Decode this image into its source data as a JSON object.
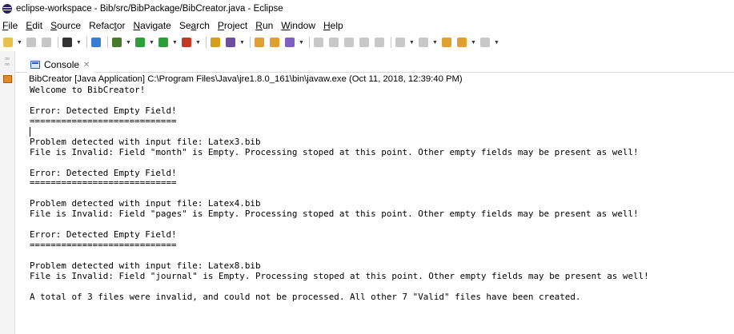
{
  "window": {
    "title": "eclipse-workspace - Bib/src/BibPackage/BibCreator.java - Eclipse",
    "app_icon": "eclipse-icon"
  },
  "menubar": {
    "items": [
      {
        "pre": "",
        "ul": "F",
        "post": "ile"
      },
      {
        "pre": "",
        "ul": "E",
        "post": "dit"
      },
      {
        "pre": "",
        "ul": "S",
        "post": "ource"
      },
      {
        "pre": "Refac",
        "ul": "t",
        "post": "or"
      },
      {
        "pre": "",
        "ul": "N",
        "post": "avigate"
      },
      {
        "pre": "Se",
        "ul": "a",
        "post": "rch"
      },
      {
        "pre": "",
        "ul": "P",
        "post": "roject"
      },
      {
        "pre": "",
        "ul": "R",
        "post": "un"
      },
      {
        "pre": "",
        "ul": "W",
        "post": "indow"
      },
      {
        "pre": "",
        "ul": "H",
        "post": "elp"
      }
    ]
  },
  "toolbar": {
    "icons": [
      {
        "name": "new-icon",
        "color": "#e8c14a",
        "dd": true
      },
      {
        "name": "save-icon",
        "color": "#c6c6c6",
        "dd": false
      },
      {
        "name": "save-all-icon",
        "color": "#c6c6c6",
        "dd": false
      },
      {
        "name": "sep"
      },
      {
        "name": "build-icon",
        "color": "#333333",
        "dd": true
      },
      {
        "name": "sep"
      },
      {
        "name": "skip-breakpoints-icon",
        "color": "#3a7bd5",
        "dd": false
      },
      {
        "name": "sep"
      },
      {
        "name": "debug-icon",
        "color": "#4a7a2e",
        "dd": true
      },
      {
        "name": "run-icon",
        "color": "#2f9e3a",
        "dd": true
      },
      {
        "name": "coverage-icon",
        "color": "#2f9e3a",
        "dd": true
      },
      {
        "name": "external-tools-icon",
        "color": "#c0392b",
        "dd": true
      },
      {
        "name": "sep"
      },
      {
        "name": "new-java-project-icon",
        "color": "#d4a017",
        "dd": false
      },
      {
        "name": "new-package-icon",
        "color": "#6b4fa0",
        "dd": true
      },
      {
        "name": "sep"
      },
      {
        "name": "open-type-icon",
        "color": "#e0a030",
        "dd": false
      },
      {
        "name": "open-task-icon",
        "color": "#e0a030",
        "dd": false
      },
      {
        "name": "search-icon",
        "color": "#7f5fc0",
        "dd": true
      },
      {
        "name": "sep"
      },
      {
        "name": "pin-icon",
        "color": "#c8c8c8",
        "dd": false
      },
      {
        "name": "toggle-mark-icon",
        "color": "#c8c8c8",
        "dd": false
      },
      {
        "name": "whitespace-icon",
        "color": "#c8c8c8",
        "dd": false
      },
      {
        "name": "block-select-icon",
        "color": "#c8c8c8",
        "dd": false
      },
      {
        "name": "show-source-icon",
        "color": "#c8c8c8",
        "dd": false
      },
      {
        "name": "sep"
      },
      {
        "name": "next-annotation-icon",
        "color": "#c8c8c8",
        "dd": true
      },
      {
        "name": "prev-annotation-icon",
        "color": "#c8c8c8",
        "dd": true
      },
      {
        "name": "last-edit-icon",
        "color": "#e0a030",
        "dd": false
      },
      {
        "name": "back-icon",
        "color": "#e0a030",
        "dd": true
      },
      {
        "name": "forward-icon",
        "color": "#c8c8c8",
        "dd": true
      }
    ]
  },
  "sidebar": {
    "restore_icon": "restore-icon",
    "console_icon": "console-icon"
  },
  "console_view": {
    "tab_label": "Console",
    "tab_close": "✕",
    "launch_info": "BibCreator [Java Application] C:\\Program Files\\Java\\jre1.8.0_161\\bin\\javaw.exe (Oct 11, 2018, 12:39:40 PM)",
    "lines": [
      "Welcome to BibCreator!",
      "",
      "Error: Detected Empty Field!",
      "============================",
      "",
      "Problem detected with input file: Latex3.bib",
      "File is Invalid: Field \"month\" is Empty. Processing stoped at this point. Other empty fields may be present as well!",
      "",
      "Error: Detected Empty Field!",
      "============================",
      "",
      "Problem detected with input file: Latex4.bib",
      "File is Invalid: Field \"pages\" is Empty. Processing stoped at this point. Other empty fields may be present as well!",
      "",
      "Error: Detected Empty Field!",
      "============================",
      "",
      "Problem detected with input file: Latex8.bib",
      "File is Invalid: Field \"journal\" is Empty. Processing stoped at this point. Other empty fields may be present as well!",
      "",
      "A total of 3 files were invalid, and could not be processed. All other 7 \"Valid\" files have been created."
    ],
    "caret_line": 4
  }
}
